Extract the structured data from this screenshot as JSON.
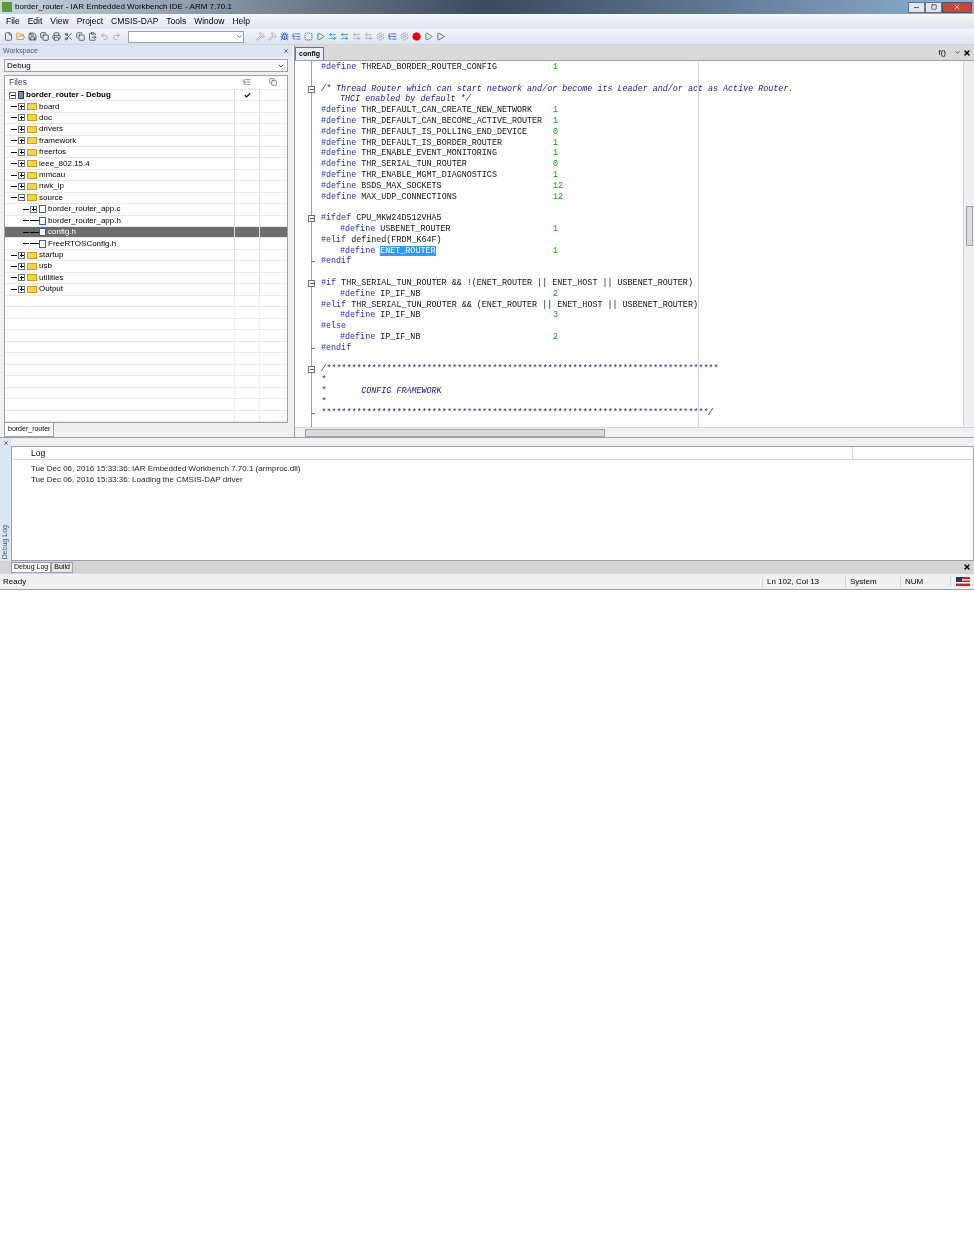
{
  "window": {
    "title": "border_router - IAR Embedded Workbench IDE - ARM 7.70.1"
  },
  "menu": [
    "File",
    "Edit",
    "View",
    "Project",
    "CMSIS-DAP",
    "Tools",
    "Window",
    "Help"
  ],
  "workspace": {
    "title": "Workspace",
    "configuration": "Debug",
    "files_header": "Files",
    "tab": "border_router",
    "tree": [
      {
        "label": "border_router - Debug",
        "kind": "project",
        "expanded": true,
        "checked": true,
        "selected": false,
        "children": [
          {
            "label": "board",
            "kind": "folder",
            "expanded": false,
            "selected": false
          },
          {
            "label": "doc",
            "kind": "folder",
            "expanded": false,
            "selected": false
          },
          {
            "label": "drivers",
            "kind": "folder",
            "expanded": false,
            "selected": false
          },
          {
            "label": "framework",
            "kind": "folder",
            "expanded": false,
            "selected": false
          },
          {
            "label": "freertos",
            "kind": "folder",
            "expanded": false,
            "selected": false
          },
          {
            "label": "ieee_802.15.4",
            "kind": "folder",
            "expanded": false,
            "selected": false
          },
          {
            "label": "mmcau",
            "kind": "folder",
            "expanded": false,
            "selected": false
          },
          {
            "label": "nwk_ip",
            "kind": "folder",
            "expanded": false,
            "selected": false
          },
          {
            "label": "source",
            "kind": "folder",
            "expanded": true,
            "selected": false,
            "children": [
              {
                "label": "border_router_app.c",
                "kind": "file",
                "expanded": false,
                "selected": false
              },
              {
                "label": "border_router_app.h",
                "kind": "file",
                "selected": false
              },
              {
                "label": "config.h",
                "kind": "file",
                "selected": true
              },
              {
                "label": "FreeRTOSConfig.h",
                "kind": "file",
                "selected": false
              }
            ]
          },
          {
            "label": "startup",
            "kind": "folder",
            "expanded": false,
            "selected": false
          },
          {
            "label": "usb",
            "kind": "folder",
            "expanded": false,
            "selected": false
          },
          {
            "label": "utilities",
            "kind": "folder",
            "expanded": false,
            "selected": false
          },
          {
            "label": "Output",
            "kind": "folder",
            "expanded": false,
            "selected": false
          }
        ]
      }
    ]
  },
  "editor": {
    "tab": {
      "label": "config",
      "selected": true
    },
    "function_button": "f()",
    "lines": [
      {
        "kind": "define",
        "keyword": "#define",
        "name": "THREAD_BORDER_ROUTER_CONFIG",
        "value": "1",
        "indented": false,
        "selected": false
      },
      {
        "kind": "blank"
      },
      {
        "kind": "comment",
        "text": "/* Thread Router which can start network and/or become its Leader and/or act as Active Router.",
        "indented": false,
        "fold_start": true
      },
      {
        "kind": "comment",
        "text": "THCI enabled by default */",
        "indented": true
      },
      {
        "kind": "define",
        "keyword": "#define",
        "name": "THR_DEFAULT_CAN_CREATE_NEW_NETWORK",
        "value": "1",
        "indented": false,
        "selected": false
      },
      {
        "kind": "define",
        "keyword": "#define",
        "name": "THR_DEFAULT_CAN_BECOME_ACTIVE_ROUTER",
        "value": "1",
        "indented": false,
        "selected": false
      },
      {
        "kind": "define",
        "keyword": "#define",
        "name": "THR_DEFAULT_IS_POLLING_END_DEVICE",
        "value": "0",
        "indented": false,
        "selected": false
      },
      {
        "kind": "define",
        "keyword": "#define",
        "name": "THR_DEFAULT_IS_BORDER_ROUTER",
        "value": "1",
        "indented": false,
        "selected": false
      },
      {
        "kind": "define",
        "keyword": "#define",
        "name": "THR_ENABLE_EVENT_MONITORING",
        "value": "1",
        "indented": false,
        "selected": false
      },
      {
        "kind": "define",
        "keyword": "#define",
        "name": "THR_SERIAL_TUN_ROUTER",
        "value": "0",
        "indented": false,
        "selected": false
      },
      {
        "kind": "define",
        "keyword": "#define",
        "name": "THR_ENABLE_MGMT_DIAGNOSTICS",
        "value": "1",
        "indented": false,
        "selected": false
      },
      {
        "kind": "define",
        "keyword": "#define",
        "name": "BSDS_MAX_SOCKETS",
        "value": "12",
        "indented": false,
        "selected": false
      },
      {
        "kind": "define",
        "keyword": "#define",
        "name": "MAX_UDP_CONNECTIONS",
        "value": "12",
        "indented": false,
        "selected": false
      },
      {
        "kind": "blank"
      },
      {
        "kind": "directive",
        "keyword": "#ifdef",
        "text": "CPU_MKW24D512VHA5",
        "fold_start": true
      },
      {
        "kind": "define",
        "keyword": "#define",
        "name": "USBENET_ROUTER",
        "value": "1",
        "indented": true,
        "selected": false
      },
      {
        "kind": "directive",
        "keyword": "#elif",
        "text": "defined(FRDM_K64F)"
      },
      {
        "kind": "define",
        "keyword": "#define",
        "name": "ENET_ROUTER",
        "value": "1",
        "indented": true,
        "selected": true
      },
      {
        "kind": "directive",
        "keyword": "#endif",
        "fold_end": true
      },
      {
        "kind": "blank"
      },
      {
        "kind": "directive",
        "keyword": "#if",
        "text": "THR_SERIAL_TUN_ROUTER && !(ENET_ROUTER || ENET_HOST || USBENET_ROUTER)",
        "fold_start": true
      },
      {
        "kind": "define",
        "keyword": "#define",
        "name": "IP_IF_NB",
        "value": "2",
        "indented": true,
        "selected": false
      },
      {
        "kind": "directive",
        "keyword": "#elif",
        "text": "THR_SERIAL_TUN_ROUTER && (ENET_ROUTER || ENET_HOST || USBENET_ROUTER)"
      },
      {
        "kind": "define",
        "keyword": "#define",
        "name": "IP_IF_NB",
        "value": "3",
        "indented": true,
        "selected": false
      },
      {
        "kind": "directive",
        "keyword": "#else"
      },
      {
        "kind": "define",
        "keyword": "#define",
        "name": "IP_IF_NB",
        "value": "2",
        "indented": true,
        "selected": false
      },
      {
        "kind": "directive",
        "keyword": "#endif",
        "fold_end": true
      },
      {
        "kind": "blank"
      },
      {
        "kind": "comment",
        "text": "/******************************************************************************",
        "indented": false,
        "fold_start": true
      },
      {
        "kind": "comment",
        "text": "*",
        "indented": false
      },
      {
        "kind": "comment",
        "text": "*       CONFIG FRAMEWORK",
        "indented": false
      },
      {
        "kind": "comment",
        "text": "*",
        "indented": false
      },
      {
        "kind": "comment",
        "text": "*****************************************************************************/",
        "indented": false,
        "fold_end": true
      }
    ]
  },
  "log": {
    "header": "Log",
    "side_label": "Debug Log",
    "entries": [
      "Tue Dec 06, 2016 15:33:36: IAR Embedded Workbench 7.70.1 (armproc.dll)",
      "Tue Dec 06, 2016 15:33:36: Loading the CMSIS-DAP driver"
    ],
    "tabs": [
      {
        "label": "Debug Log",
        "selected": true
      },
      {
        "label": "Build",
        "selected": false
      }
    ]
  },
  "status_bar": {
    "message": "Ready",
    "position": "Ln 102, Col 13",
    "encoding": "System",
    "num_lock": "NUM"
  }
}
